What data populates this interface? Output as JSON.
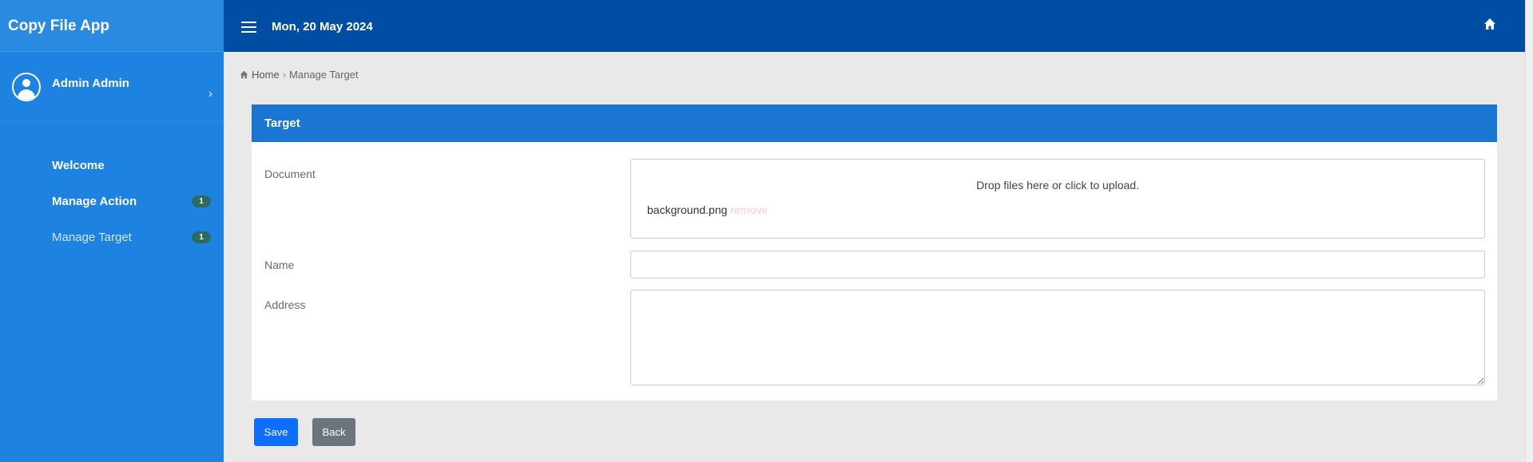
{
  "app": {
    "title": "Copy File App"
  },
  "user": {
    "name": "Admin Admin"
  },
  "menu": {
    "items": [
      {
        "label": "Welcome"
      },
      {
        "label": "Manage Action",
        "badge": "1"
      },
      {
        "label": "Manage Target",
        "badge": "1"
      }
    ]
  },
  "topbar": {
    "date": "Mon, 20 May 2024"
  },
  "breadcrumb": {
    "home": "Home",
    "separator": "›",
    "current": "Manage Target"
  },
  "card": {
    "title": "Target"
  },
  "form": {
    "document_label": "Document",
    "dropzone_message": "Drop files here or click to upload.",
    "file_name": "background.png",
    "remove_label": "remove",
    "name_label": "Name",
    "name_value": "",
    "address_label": "Address",
    "address_value": ""
  },
  "buttons": {
    "save": "Save",
    "back": "Back"
  },
  "colors": {
    "sidebar": "#1e82e0",
    "topbar": "#004ea3",
    "card_header": "#1b76d3",
    "save": "#0d6efd",
    "back": "#6c757d",
    "badge": "#2d6a61"
  }
}
